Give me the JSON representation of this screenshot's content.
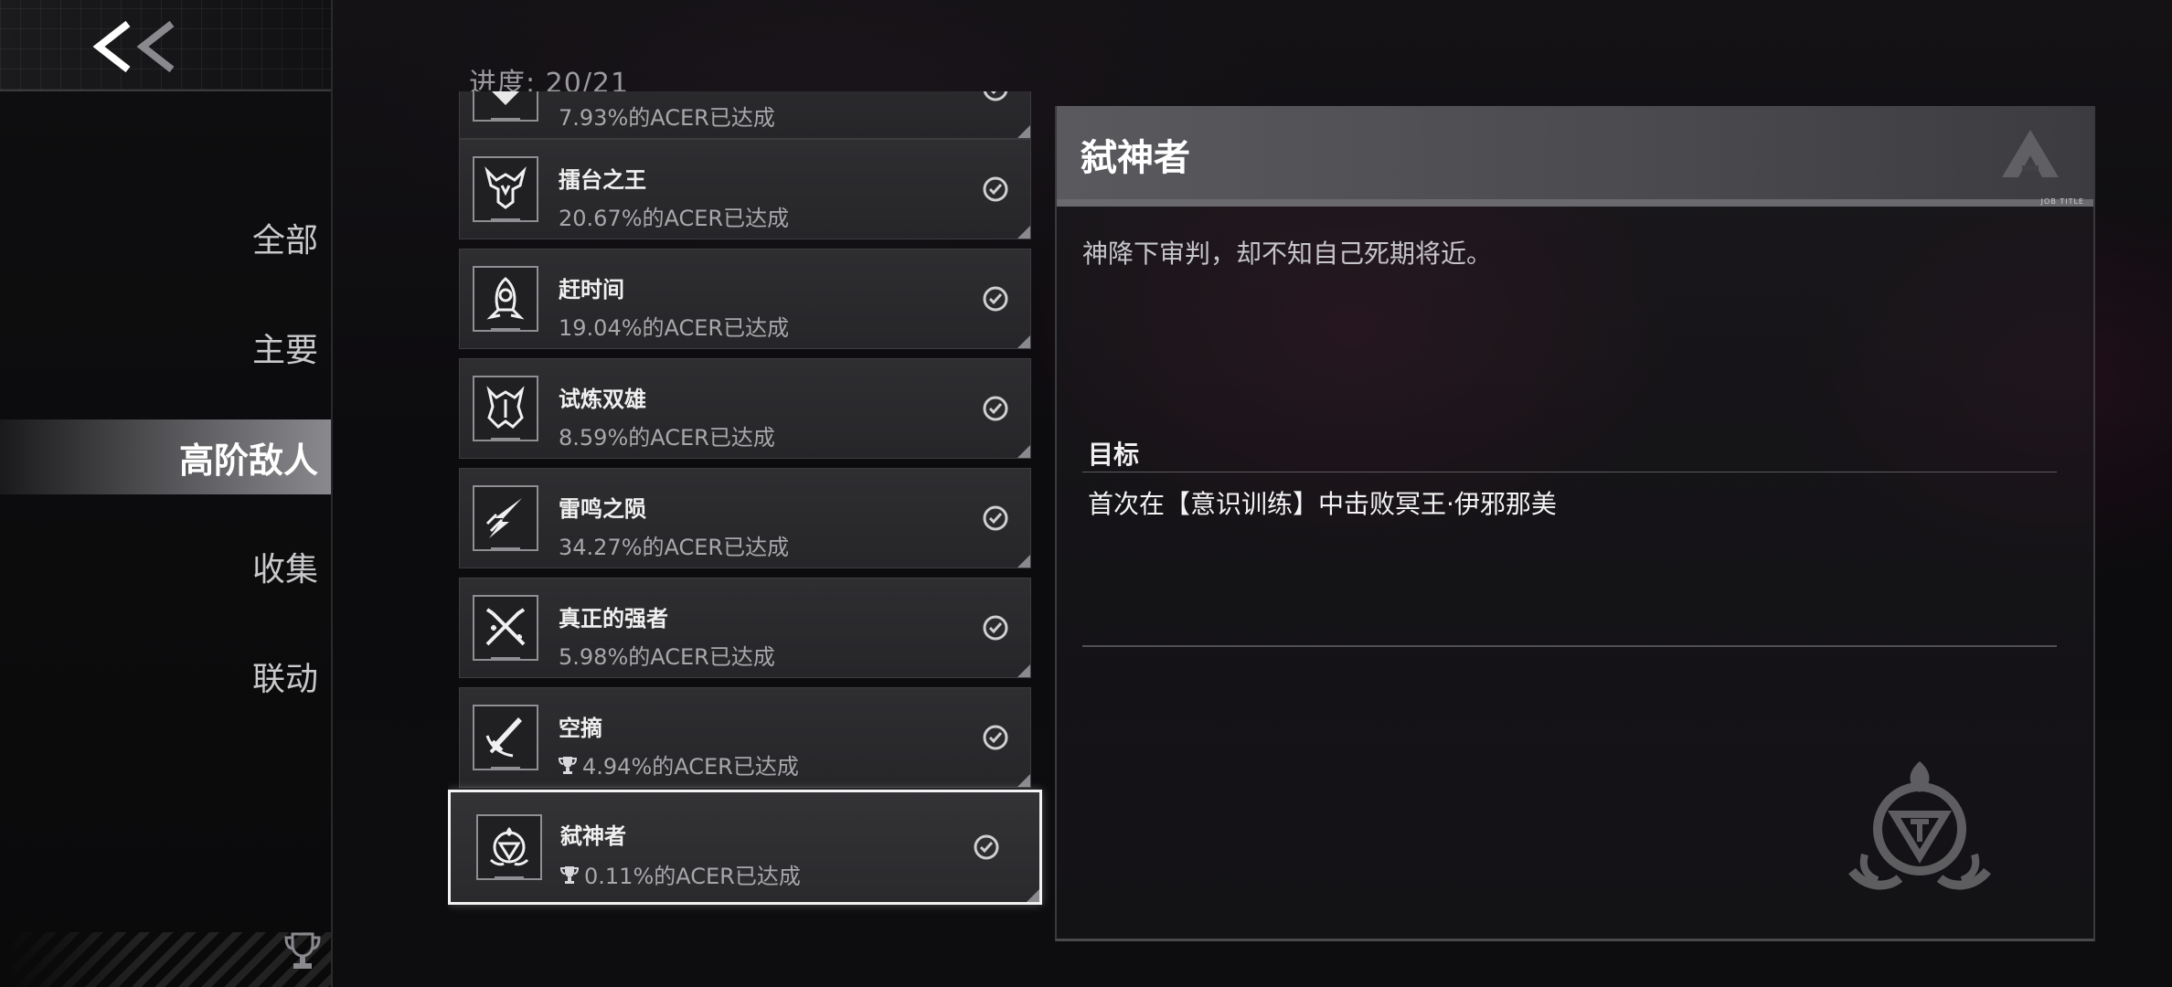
{
  "sidebar": {
    "back_icon": "double-chevron-left-icon",
    "items": [
      {
        "label": "全部",
        "active": false
      },
      {
        "label": "主要",
        "active": false
      },
      {
        "label": "高阶敌人",
        "active": true
      },
      {
        "label": "收集",
        "active": false
      },
      {
        "label": "联动",
        "active": false
      }
    ],
    "bottom_icon": "trophy-icon"
  },
  "progress_text": "进度: 20/21",
  "achievements": [
    {
      "title": "",
      "rate": "7.93%的ACER已达成",
      "icon": "heart-emblem-icon",
      "completed": true,
      "trophy": false
    },
    {
      "title": "擂台之王",
      "rate": "20.67%的ACER已达成",
      "icon": "horned-helmet-icon",
      "completed": true,
      "trophy": false
    },
    {
      "title": "赶时间",
      "rate": "19.04%的ACER已达成",
      "icon": "rocket-clock-icon",
      "completed": true,
      "trophy": false
    },
    {
      "title": "试炼双雄",
      "rate": "8.59%的ACER已达成",
      "icon": "twin-mask-icon",
      "completed": true,
      "trophy": false
    },
    {
      "title": "雷鸣之陨",
      "rate": "34.27%的ACER已达成",
      "icon": "lightning-strike-icon",
      "completed": true,
      "trophy": false
    },
    {
      "title": "真正的强者",
      "rate": "5.98%的ACER已达成",
      "icon": "crossed-blades-icon",
      "completed": true,
      "trophy": false
    },
    {
      "title": "空摘",
      "rate": "4.94%的ACER已达成",
      "icon": "sword-slash-icon",
      "completed": true,
      "trophy": true
    },
    {
      "title": "弑神者",
      "rate": "0.11%的ACER已达成",
      "icon": "god-emblem-icon",
      "completed": true,
      "trophy": true,
      "selected": true
    }
  ],
  "detail": {
    "title": "弑神者",
    "description": "神降下审判，却不知自己死期将近。",
    "goal_label": "目标",
    "goal_text": "首次在【意识训练】中击败冥王·伊邪那美",
    "header_small_text": "JOB TITLE"
  },
  "colors": {
    "background": "#0b0b0d",
    "card": "#2e2e31",
    "active_nav": "#6a6a6e",
    "selected_border": "#f2f2f2"
  }
}
